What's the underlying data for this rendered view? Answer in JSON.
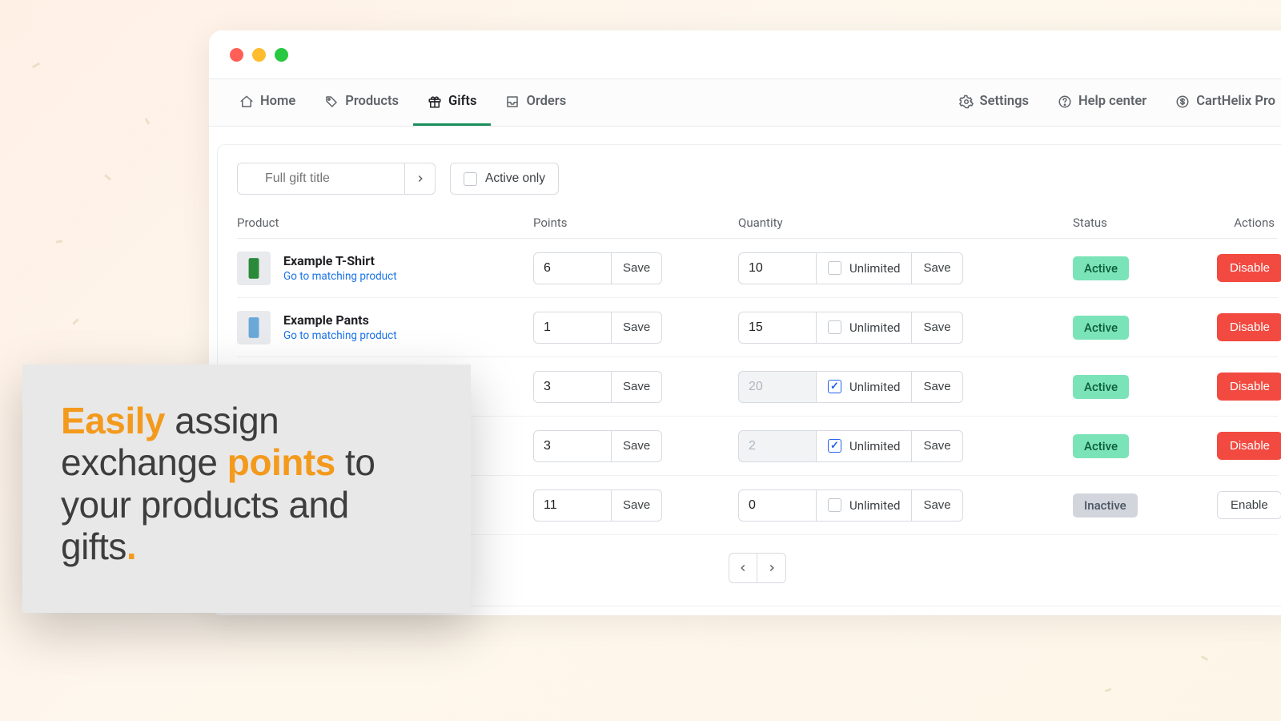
{
  "nav": {
    "primary": [
      {
        "label": "Home",
        "icon": "home"
      },
      {
        "label": "Products",
        "icon": "tag"
      },
      {
        "label": "Gifts",
        "icon": "gift",
        "active": true
      },
      {
        "label": "Orders",
        "icon": "inbox"
      }
    ],
    "secondary": [
      {
        "label": "Settings",
        "icon": "gear"
      },
      {
        "label": "Help center",
        "icon": "help"
      },
      {
        "label": "CartHelix Pro",
        "icon": "dollar"
      }
    ]
  },
  "filters": {
    "search_placeholder": "Full gift title",
    "active_only_label": "Active only"
  },
  "columns": {
    "product": "Product",
    "points": "Points",
    "quantity": "Quantity",
    "status": "Status",
    "actions": "Actions"
  },
  "labels": {
    "save": "Save",
    "unlimited": "Unlimited",
    "go_to_product": "Go to matching product",
    "status_active": "Active",
    "status_inactive": "Inactive",
    "disable": "Disable",
    "enable": "Enable"
  },
  "rows": [
    {
      "title": "Example T-Shirt",
      "thumb_color": "#2a8a3a",
      "points": "6",
      "qty": "10",
      "unlimited": false,
      "status": "active"
    },
    {
      "title": "Example Pants",
      "thumb_color": "#6aa8d8",
      "points": "1",
      "qty": "15",
      "unlimited": false,
      "status": "active"
    },
    {
      "title": "",
      "thumb_color": "",
      "points": "3",
      "qty": "20",
      "unlimited": true,
      "status": "active"
    },
    {
      "title": "",
      "thumb_color": "",
      "points": "3",
      "qty": "2",
      "unlimited": true,
      "status": "active"
    },
    {
      "title": "",
      "thumb_color": "",
      "points": "11",
      "qty": "0",
      "unlimited": false,
      "status": "inactive"
    }
  ],
  "promo": {
    "w1": "Easily",
    "t1": " assign exchange ",
    "w2": "points",
    "t2": " to your products and gifts",
    "dot": "."
  }
}
